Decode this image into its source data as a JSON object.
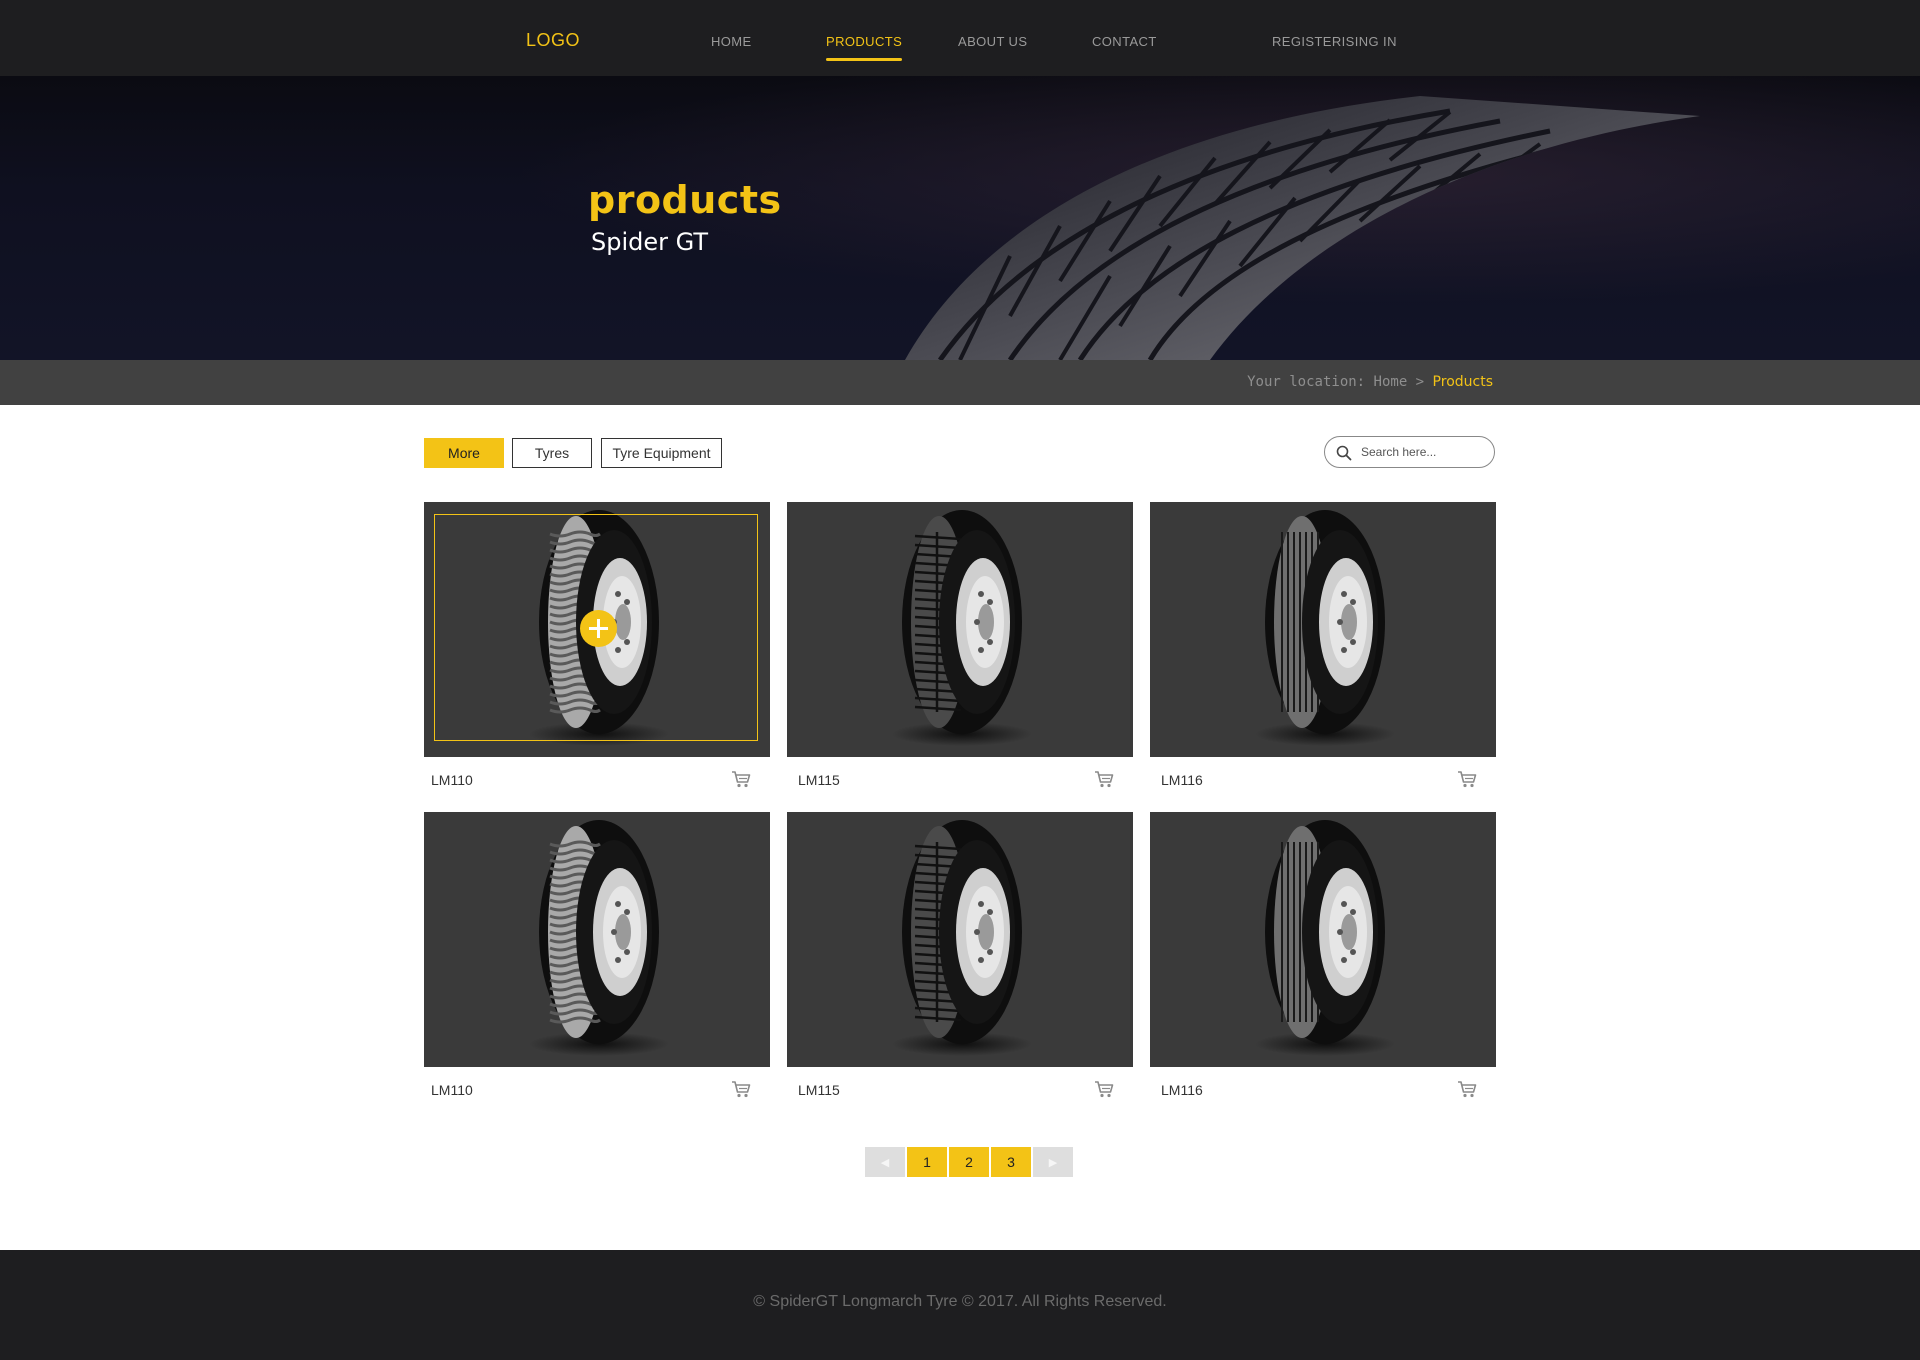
{
  "header": {
    "logo": "LOGO",
    "nav": [
      {
        "label": "HOME"
      },
      {
        "label": "PRODUCTS"
      },
      {
        "label": "ABOUT  US"
      },
      {
        "label": "CONTACT"
      },
      {
        "label": "REGISTERISING IN"
      }
    ],
    "active_index": 1
  },
  "hero": {
    "title": "products",
    "subtitle": "Spider GT"
  },
  "breadcrumb": {
    "prefix": "Your location: Home > ",
    "current": "Products"
  },
  "filters": {
    "buttons": [
      {
        "label": "More",
        "active": true
      },
      {
        "label": "Tyres",
        "active": false
      },
      {
        "label": "Tyre Equipment",
        "active": false
      }
    ]
  },
  "search": {
    "placeholder": "Search here..."
  },
  "products": [
    {
      "name": "LM110",
      "tread": "ribbed-block",
      "hovered": true
    },
    {
      "name": "LM115",
      "tread": "block",
      "hovered": false
    },
    {
      "name": "LM116",
      "tread": "rib",
      "hovered": false
    },
    {
      "name": "LM110",
      "tread": "ribbed-block",
      "hovered": false
    },
    {
      "name": "LM115",
      "tread": "block",
      "hovered": false
    },
    {
      "name": "LM116",
      "tread": "rib",
      "hovered": false
    }
  ],
  "pagination": {
    "prev_icon": "◀",
    "pages": [
      "1",
      "2",
      "3"
    ],
    "next_icon": "▶"
  },
  "footer": {
    "copyright": "© SpiderGT Longmarch Tyre © 2017. All Rights Reserved."
  },
  "colors": {
    "accent": "#f3c316",
    "header_bg": "#1e1e20",
    "card_bg": "#3a3a3a",
    "breadcrumb_bg": "#414141"
  },
  "icons": {
    "search": "search-icon",
    "cart": "cart-icon",
    "plus": "plus-icon"
  }
}
